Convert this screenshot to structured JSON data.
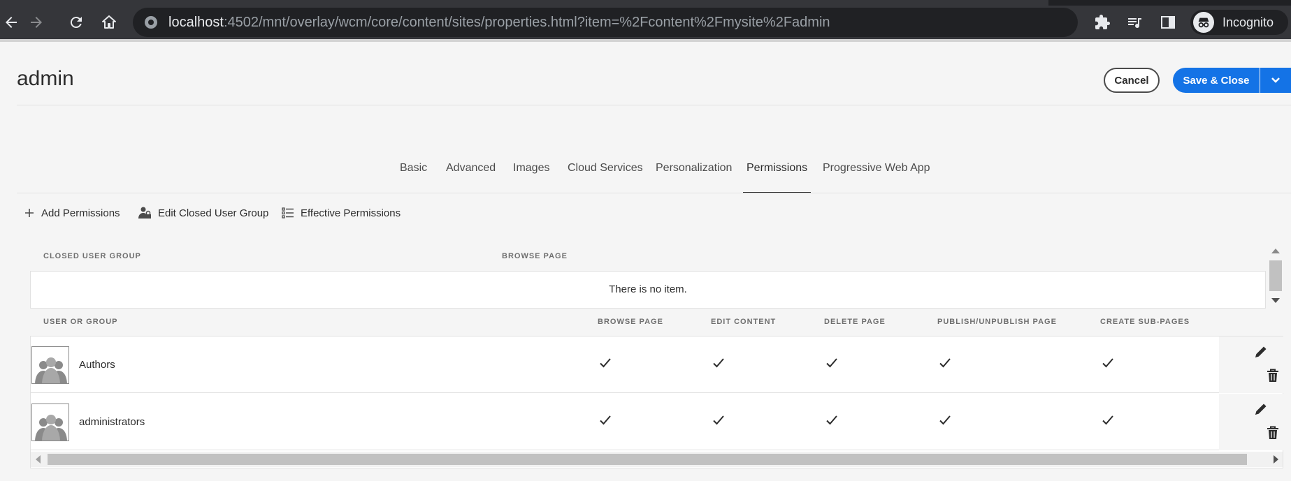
{
  "browser": {
    "url_host": "localhost",
    "url_rest": ":4502/mnt/overlay/wcm/core/content/sites/properties.html?item=%2Fcontent%2Fmysite%2Fadmin",
    "profile_label": "Incognito",
    "icons": [
      "back-icon",
      "forward-icon",
      "reload-icon",
      "home-icon",
      "site-info-icon",
      "extensions-icon",
      "media-queue-icon",
      "side-panel-icon",
      "incognito-icon"
    ]
  },
  "header": {
    "title": "admin",
    "cancel_label": "Cancel",
    "save_label": "Save & Close"
  },
  "tabs": [
    {
      "label": "Basic",
      "active": false
    },
    {
      "label": "Advanced",
      "active": false
    },
    {
      "label": "Images",
      "active": false
    },
    {
      "label": "Cloud Services",
      "active": false
    },
    {
      "label": "Personalization",
      "active": false
    },
    {
      "label": "Permissions",
      "active": true
    },
    {
      "label": "Progressive Web App",
      "active": false
    }
  ],
  "actions": {
    "add": "Add Permissions",
    "cug": "Edit Closed User Group",
    "effective": "Effective Permissions"
  },
  "cug_table": {
    "headers": [
      "CLOSED USER GROUP",
      "BROWSE PAGE"
    ],
    "empty_text": "There is no item."
  },
  "perm_table": {
    "headers": [
      "USER OR GROUP",
      "BROWSE PAGE",
      "EDIT CONTENT",
      "DELETE PAGE",
      "PUBLISH/UNPUBLISH PAGE",
      "CREATE SUB-PAGES"
    ],
    "rows": [
      {
        "name": "Authors",
        "browse": true,
        "edit": true,
        "delete": true,
        "publish": true,
        "create": true
      },
      {
        "name": "administrators",
        "browse": true,
        "edit": true,
        "delete": true,
        "publish": true,
        "create": true
      }
    ]
  },
  "colors": {
    "accent": "#1473e6",
    "chrome_bg": "#35363a",
    "omnibox_bg": "#202124",
    "page_bg": "#f5f5f5"
  }
}
